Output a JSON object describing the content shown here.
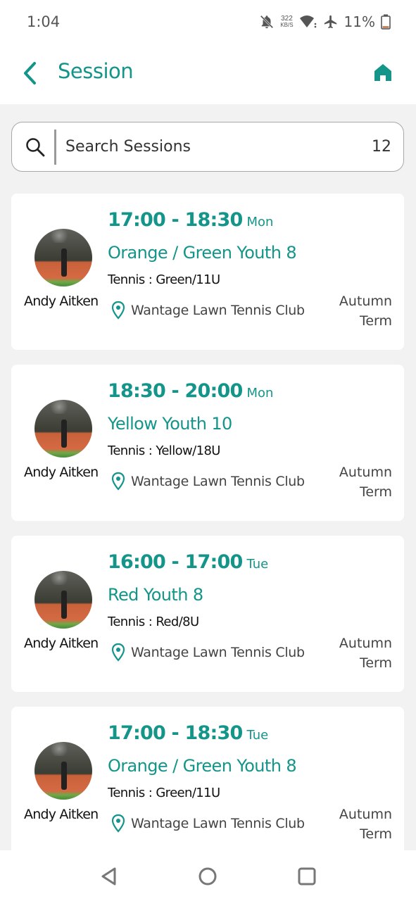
{
  "status_bar": {
    "time": "1:04",
    "net_speed_value": "322",
    "net_speed_unit": "KB/S",
    "battery": "11%",
    "icons": [
      "bell-off-icon",
      "wifi-icon",
      "airplane-icon",
      "battery-icon"
    ]
  },
  "app_bar": {
    "title": "Session",
    "back_icon": "chevron-left-icon",
    "home_icon": "home-icon"
  },
  "search": {
    "placeholder": "Search Sessions",
    "value": "",
    "count": "12"
  },
  "colors": {
    "accent": "#14958a",
    "background": "#f2f2f2",
    "card": "#ffffff"
  },
  "sessions": [
    {
      "coach": "Andy Aitken",
      "time_range": "17:00 - 18:30",
      "day": "Mon",
      "name": "Orange / Green Youth 8",
      "category": "Tennis : Green/11U",
      "venue": "Wantage Lawn Tennis Club",
      "term_line1": "Autumn",
      "term_line2": "Term"
    },
    {
      "coach": "Andy Aitken",
      "time_range": "18:30 - 20:00",
      "day": "Mon",
      "name": "Yellow Youth 10",
      "category": "Tennis : Yellow/18U",
      "venue": "Wantage Lawn Tennis Club",
      "term_line1": "Autumn",
      "term_line2": "Term"
    },
    {
      "coach": "Andy Aitken",
      "time_range": "16:00 - 17:00",
      "day": "Tue",
      "name": "Red Youth 8",
      "category": "Tennis : Red/8U",
      "venue": "Wantage Lawn Tennis Club",
      "term_line1": "Autumn",
      "term_line2": "Term"
    },
    {
      "coach": "Andy Aitken",
      "time_range": "17:00 - 18:30",
      "day": "Tue",
      "name": "Orange / Green Youth 8",
      "category": "Tennis : Green/11U",
      "venue": "Wantage Lawn Tennis Club",
      "term_line1": "Autumn",
      "term_line2": "Term"
    }
  ],
  "nav_bar": {
    "icons": [
      "back-nav-icon",
      "home-nav-icon",
      "recents-nav-icon"
    ]
  }
}
